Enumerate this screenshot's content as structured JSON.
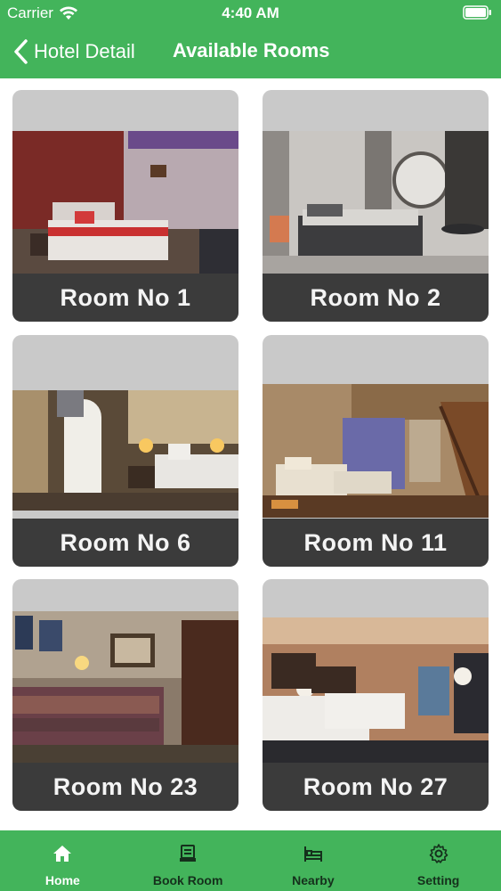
{
  "status_bar": {
    "carrier": "Carrier",
    "time": "4:40 AM"
  },
  "nav": {
    "back_label": "Hotel Detail",
    "title": "Available Rooms"
  },
  "rooms": [
    {
      "label": "Room No 1"
    },
    {
      "label": "Room No 2"
    },
    {
      "label": "Room No 6"
    },
    {
      "label": "Room No 11"
    },
    {
      "label": "Room No 23"
    },
    {
      "label": "Room No 27"
    }
  ],
  "tabs": [
    {
      "label": "Home",
      "icon": "home-icon"
    },
    {
      "label": "Book Room",
      "icon": "book-room-icon"
    },
    {
      "label": "Nearby",
      "icon": "bed-icon"
    },
    {
      "label": "Setting",
      "icon": "gear-icon"
    }
  ],
  "active_tab": "Home",
  "colors": {
    "accent": "#43b45b",
    "label_bar": "#3b3b3b",
    "card_bg": "#c9c9c9"
  }
}
